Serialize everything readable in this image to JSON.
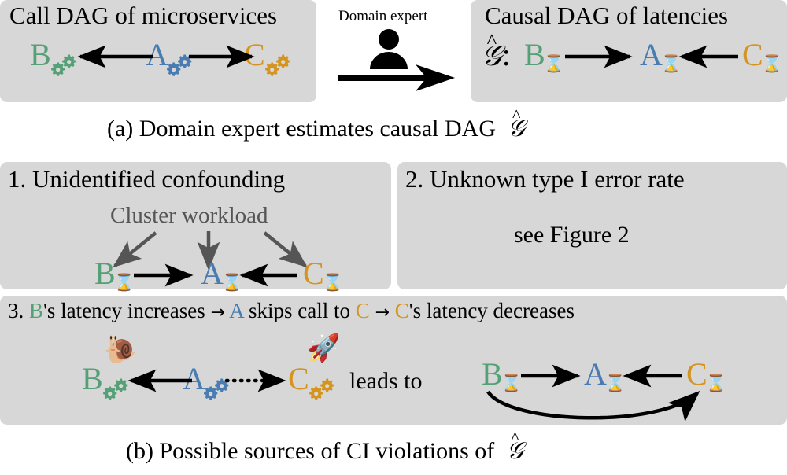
{
  "figure": {
    "caption_a": "(a) Domain expert estimates causal DAG",
    "caption_a_symbol": "𝒢",
    "caption_b": "(b) Possible sources of CI violations of",
    "caption_b_symbol": "𝒢"
  },
  "colors": {
    "panel_bg": "#d7d7d7",
    "green": "#55a076",
    "blue": "#4a7cb2",
    "orange": "#d4941f",
    "gray": "#555555",
    "black": "#000000",
    "page_bg": "#ffffff"
  },
  "panel_call_dag": {
    "title": "Call DAG of microservices",
    "nodes": [
      {
        "label": "B",
        "color_name": "green",
        "icon": "gears-icon"
      },
      {
        "label": "A",
        "color_name": "blue",
        "icon": "gears-icon"
      },
      {
        "label": "C",
        "color_name": "orange",
        "icon": "gears-icon"
      }
    ],
    "edges": [
      {
        "from": "A",
        "to": "B",
        "style": "solid",
        "direction": "left"
      },
      {
        "from": "A",
        "to": "C",
        "style": "solid",
        "direction": "right"
      }
    ]
  },
  "panel_expert": {
    "label": "Domain expert",
    "icon": "person-icon",
    "arrow": "long-right-arrow"
  },
  "panel_causal_dag": {
    "title": "Causal DAG of latencies",
    "graph_symbol": "𝒢",
    "graph_symbol_suffix": ":",
    "nodes": [
      {
        "label": "B",
        "color_name": "green",
        "icon": "hourglass-icon"
      },
      {
        "label": "A",
        "color_name": "blue",
        "icon": "hourglass-icon"
      },
      {
        "label": "C",
        "color_name": "orange",
        "icon": "hourglass-icon"
      }
    ],
    "edges": [
      {
        "from": "B",
        "to": "A",
        "style": "solid",
        "direction": "right"
      },
      {
        "from": "C",
        "to": "A",
        "style": "solid",
        "direction": "left"
      }
    ]
  },
  "panel_1": {
    "title": "1. Unidentified confounding",
    "confounder_label": "Cluster workload",
    "nodes": [
      {
        "label": "B",
        "color_name": "green",
        "icon": "hourglass-icon"
      },
      {
        "label": "A",
        "color_name": "blue",
        "icon": "hourglass-icon"
      },
      {
        "label": "C",
        "color_name": "orange",
        "icon": "hourglass-icon"
      }
    ],
    "edges": [
      {
        "from": "Cluster workload",
        "to": "B",
        "style": "solid",
        "color_name": "gray"
      },
      {
        "from": "Cluster workload",
        "to": "A",
        "style": "solid",
        "color_name": "gray"
      },
      {
        "from": "Cluster workload",
        "to": "C",
        "style": "solid",
        "color_name": "gray"
      },
      {
        "from": "B",
        "to": "A",
        "style": "solid",
        "color_name": "black"
      },
      {
        "from": "C",
        "to": "A",
        "style": "solid",
        "color_name": "black"
      }
    ]
  },
  "panel_2": {
    "title": "2. Unknown type I error rate",
    "body": "see Figure 2"
  },
  "panel_3": {
    "headline": {
      "prefix": "3.",
      "b_letter": "B",
      "seg1": "'s latency increases",
      "arrow1": "→",
      "a_letter": "A",
      "seg2": "skips call to",
      "c_letter": "C",
      "arrow2": "→",
      "c_letter2": "C",
      "seg3": "'s latency decreases"
    },
    "left_graph": {
      "nodes": [
        {
          "label": "B",
          "color_name": "green",
          "icon": "gears-icon",
          "badge": "snail-icon",
          "badge_glyph": "🐌"
        },
        {
          "label": "A",
          "color_name": "blue",
          "icon": "gears-icon"
        },
        {
          "label": "C",
          "color_name": "orange",
          "icon": "gears-icon",
          "badge": "rocket-icon",
          "badge_glyph": "🚀"
        }
      ],
      "edges": [
        {
          "from": "A",
          "to": "B",
          "style": "solid",
          "direction": "left"
        },
        {
          "from": "A",
          "to": "C",
          "style": "dotted",
          "direction": "right"
        }
      ]
    },
    "connector_label": "leads to",
    "right_graph": {
      "nodes": [
        {
          "label": "B",
          "color_name": "green",
          "icon": "hourglass-icon"
        },
        {
          "label": "A",
          "color_name": "blue",
          "icon": "hourglass-icon"
        },
        {
          "label": "C",
          "color_name": "orange",
          "icon": "hourglass-icon"
        }
      ],
      "edges": [
        {
          "from": "B",
          "to": "A",
          "style": "solid",
          "direction": "right"
        },
        {
          "from": "C",
          "to": "A",
          "style": "solid",
          "direction": "left"
        },
        {
          "from": "B",
          "to": "C",
          "style": "curved-solid",
          "direction": "right"
        }
      ]
    }
  }
}
